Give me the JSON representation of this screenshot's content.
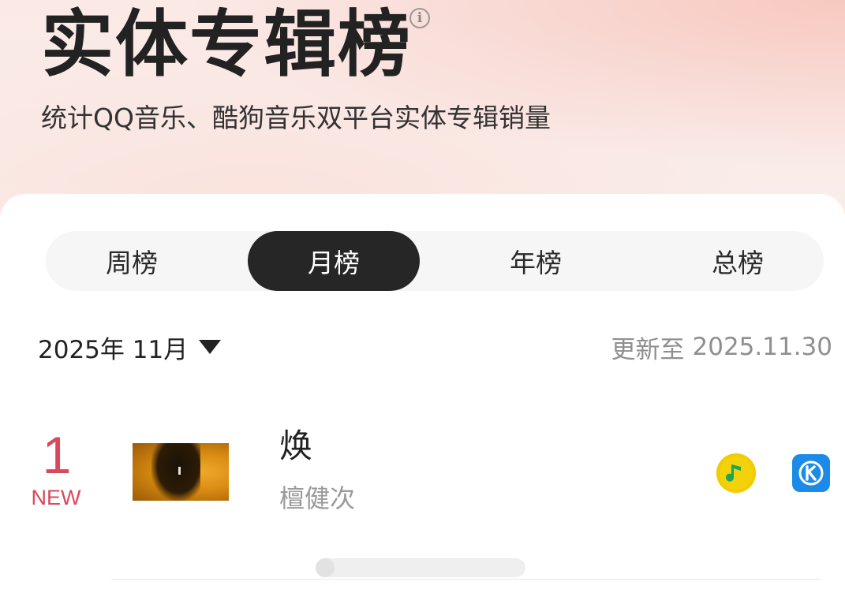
{
  "header": {
    "title": "实体专辑榜",
    "info_icon": "info-icon",
    "subtitle": "统计QQ音乐、酷狗音乐双平台实体专辑销量"
  },
  "tabs": [
    {
      "label": "周榜",
      "active": false
    },
    {
      "label": "月榜",
      "active": true
    },
    {
      "label": "年榜",
      "active": false
    },
    {
      "label": "总榜",
      "active": false
    }
  ],
  "date_filter": {
    "value": "2025年 11月",
    "icon": "caret-down-icon"
  },
  "update": {
    "label": "更新至",
    "date": "2025.11.30"
  },
  "entries": [
    {
      "rank": "1",
      "badge": "NEW",
      "title": "焕",
      "artist": "檀健次",
      "platform_icons": [
        "qq-music-icon",
        "kugou-icon"
      ]
    }
  ],
  "colors": {
    "rank": "#d9485b",
    "active_tab_bg": "#262626",
    "qq_yellow": "#f3d20c",
    "qq_green": "#1aa557",
    "kugou_blue": "#1c8be8"
  }
}
